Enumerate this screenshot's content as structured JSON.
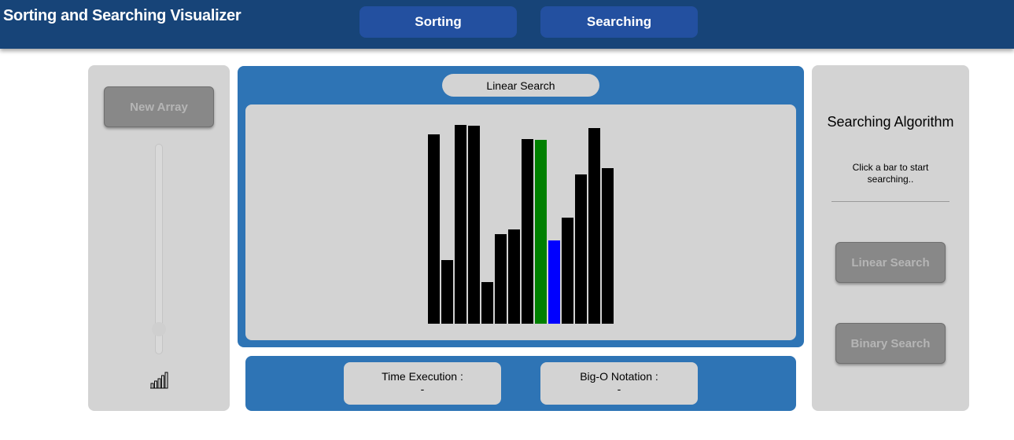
{
  "header": {
    "title": "Sorting and Searching Visualizer",
    "nav": [
      {
        "label": "Sorting"
      },
      {
        "label": "Searching"
      }
    ]
  },
  "left_panel": {
    "new_array_label": "New Array",
    "speed_icon": "signal-bars-icon"
  },
  "visualizer": {
    "algorithm_label": "Linear Search",
    "bars": [
      {
        "value": 241,
        "state": "default"
      },
      {
        "value": 81,
        "state": "default"
      },
      {
        "value": 253,
        "state": "default"
      },
      {
        "value": 252,
        "state": "default"
      },
      {
        "value": 53,
        "state": "default"
      },
      {
        "value": 114,
        "state": "default"
      },
      {
        "value": 120,
        "state": "default"
      },
      {
        "value": 235,
        "state": "default"
      },
      {
        "value": 234,
        "state": "found"
      },
      {
        "value": 106,
        "state": "current"
      },
      {
        "value": 135,
        "state": "default"
      },
      {
        "value": 190,
        "state": "default"
      },
      {
        "value": 249,
        "state": "default"
      },
      {
        "value": 198,
        "state": "default"
      }
    ],
    "colors": {
      "default": "#000000",
      "found": "#008000",
      "current": "#0000ff"
    }
  },
  "stats": {
    "time_label": "Time Execution :",
    "time_value": "-",
    "bigo_label": "Big-O Notation :",
    "bigo_value": "-"
  },
  "right_panel": {
    "heading": "Searching Algorithm",
    "hint": "Click a bar to start searching..",
    "linear_label": "Linear Search",
    "binary_label": "Binary Search"
  }
}
